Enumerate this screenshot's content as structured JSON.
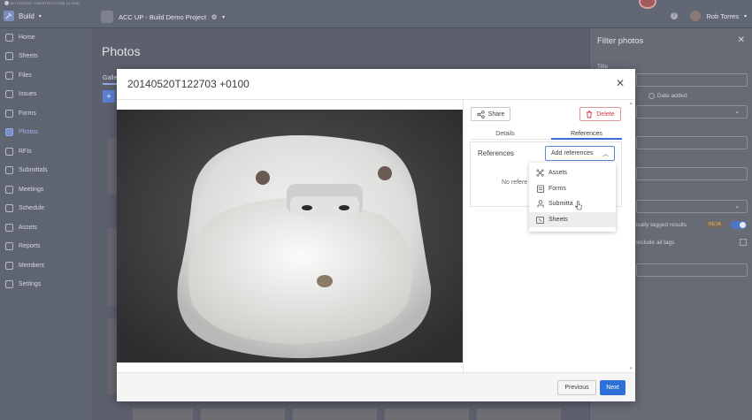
{
  "app": {
    "brand_line": "AUTODESK CONSTRUCTION CLOUD",
    "module": "Build",
    "project": "ACC UP - Build Demo Project",
    "user": "Rob Torres"
  },
  "sidebar": {
    "items": [
      {
        "label": "Home",
        "icon": "home-icon"
      },
      {
        "label": "Sheets",
        "icon": "sheets-icon"
      },
      {
        "label": "Files",
        "icon": "files-icon"
      },
      {
        "label": "Issues",
        "icon": "issues-icon"
      },
      {
        "label": "Forms",
        "icon": "forms-icon"
      },
      {
        "label": "Photos",
        "icon": "photos-icon",
        "active": true
      },
      {
        "label": "RFIs",
        "icon": "rfis-icon"
      },
      {
        "label": "Submittals",
        "icon": "submittals-icon"
      },
      {
        "label": "Meetings",
        "icon": "meetings-icon"
      },
      {
        "label": "Schedule",
        "icon": "schedule-icon"
      },
      {
        "label": "Assets",
        "icon": "assets-icon"
      },
      {
        "label": "Reports",
        "icon": "reports-icon"
      },
      {
        "label": "Members",
        "icon": "members-icon"
      },
      {
        "label": "Settings",
        "icon": "settings-icon"
      }
    ]
  },
  "main": {
    "title": "Photos",
    "tab_partial": "Galle",
    "add_label": "+"
  },
  "filter": {
    "title": "Filter photos",
    "title_field_label": "Title",
    "date_added_label": "Date added",
    "ai_tags_label": "ically tagged results",
    "beta": "BETA",
    "include_all_tags": "Include all tags"
  },
  "modal": {
    "title": "20140520T122703 +0100",
    "share_label": "Share",
    "delete_label": "Delete",
    "tabs": [
      "Details",
      "References"
    ],
    "active_tab": "References",
    "references_heading": "References",
    "add_references_label": "Add references",
    "no_references_text": "No refere",
    "dropdown_options": [
      {
        "label": "Assets",
        "icon": "assets-icon"
      },
      {
        "label": "Forms",
        "icon": "forms-icon"
      },
      {
        "label": "Submitta",
        "icon": "submittals-icon"
      },
      {
        "label": "Sheets",
        "icon": "sheets-icon",
        "hovered": true
      }
    ],
    "previous_label": "Previous",
    "next_label": "Next"
  },
  "colors": {
    "accent": "#2f6fd8",
    "delete": "#d03b3b"
  }
}
